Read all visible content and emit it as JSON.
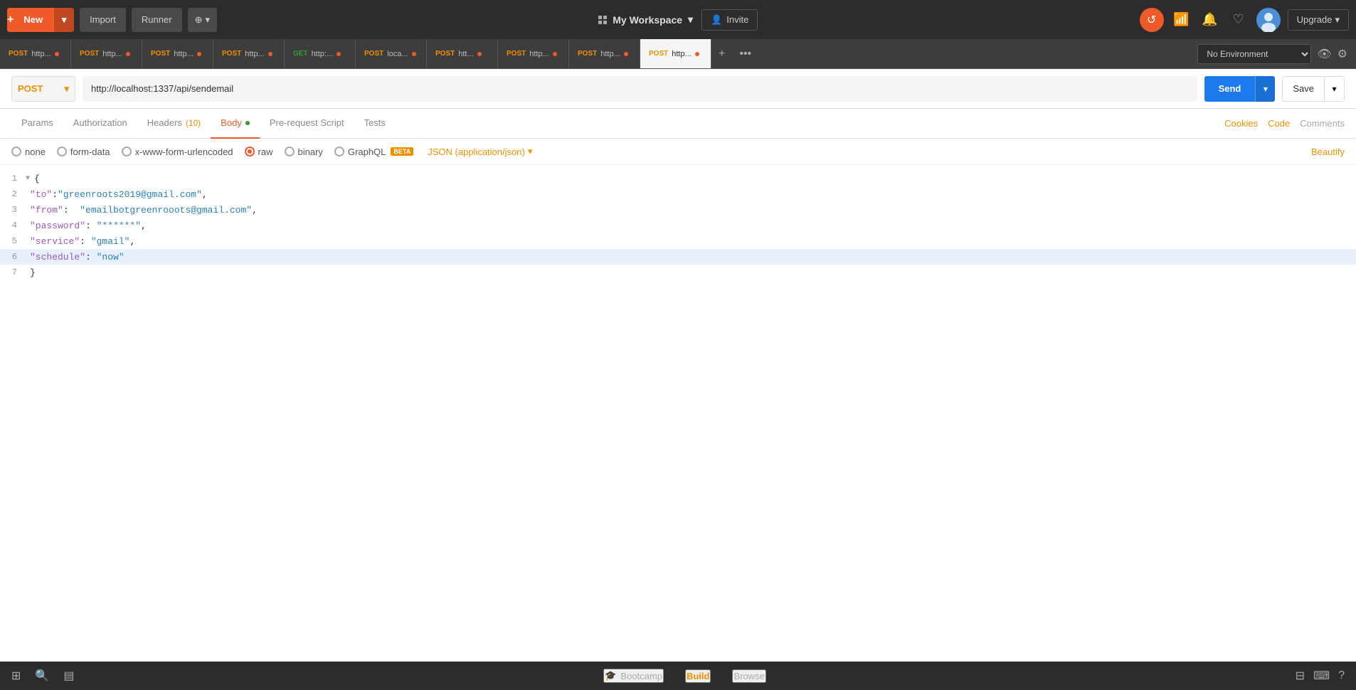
{
  "navbar": {
    "new_label": "New",
    "import_label": "Import",
    "runner_label": "Runner",
    "workspace_label": "My Workspace",
    "invite_label": "Invite",
    "upgrade_label": "Upgrade"
  },
  "tabs": [
    {
      "method": "POST",
      "url": "http...",
      "dot": "orange",
      "active": false
    },
    {
      "method": "POST",
      "url": "http...",
      "dot": "orange",
      "active": false
    },
    {
      "method": "POST",
      "url": "http...",
      "dot": "orange",
      "active": false
    },
    {
      "method": "POST",
      "url": "http...",
      "dot": "orange",
      "active": false
    },
    {
      "method": "GET",
      "url": "http:...",
      "dot": "orange",
      "active": false
    },
    {
      "method": "POST",
      "url": "loca...",
      "dot": "orange",
      "active": false
    },
    {
      "method": "POST",
      "url": "htt...",
      "dot": "orange",
      "active": false
    },
    {
      "method": "POST",
      "url": "http...",
      "dot": "orange",
      "active": false
    },
    {
      "method": "POST",
      "url": "http...",
      "dot": "orange",
      "active": false
    },
    {
      "method": "POST",
      "url": "http...",
      "dot": "orange",
      "active": true
    }
  ],
  "environment": {
    "label": "No Environment"
  },
  "request": {
    "method": "POST",
    "url": "http://localhost:1337/api/sendemail",
    "send_label": "Send",
    "save_label": "Save"
  },
  "req_tabs": {
    "tabs": [
      {
        "label": "Params",
        "active": false
      },
      {
        "label": "Authorization",
        "active": false
      },
      {
        "label": "Headers",
        "badge": "(10)",
        "active": false
      },
      {
        "label": "Body",
        "dot": true,
        "active": true
      },
      {
        "label": "Pre-request Script",
        "active": false
      },
      {
        "label": "Tests",
        "active": false
      }
    ],
    "right_links": [
      "Cookies",
      "Code",
      "Comments"
    ]
  },
  "body_format": {
    "options": [
      "none",
      "form-data",
      "x-www-form-urlencoded",
      "raw",
      "binary",
      "GraphQL"
    ],
    "selected": "raw",
    "graphql_beta": "BETA",
    "content_type": "JSON (application/json)",
    "beautify_label": "Beautify"
  },
  "code": {
    "lines": [
      {
        "num": "1",
        "arrow": "▼",
        "content": "{",
        "highlighted": false
      },
      {
        "num": "2",
        "arrow": "",
        "content": "    \"to\":\"greenroots2019@gmail.com\",",
        "highlighted": false
      },
      {
        "num": "3",
        "arrow": "",
        "content": "    \"from\":  \"emailbotgreenrooots@gmail.com\",",
        "highlighted": false
      },
      {
        "num": "4",
        "arrow": "",
        "content": "    \"password\": \"******\",",
        "highlighted": false
      },
      {
        "num": "5",
        "arrow": "",
        "content": "    \"service\": \"gmail\",",
        "highlighted": false
      },
      {
        "num": "6",
        "arrow": "",
        "content": "    \"schedule\": \"now\"",
        "highlighted": true
      },
      {
        "num": "7",
        "arrow": "",
        "content": "}",
        "highlighted": false
      }
    ]
  },
  "bottom_bar": {
    "bootcamp_label": "Bootcamp",
    "build_label": "Build",
    "browse_label": "Browse"
  }
}
